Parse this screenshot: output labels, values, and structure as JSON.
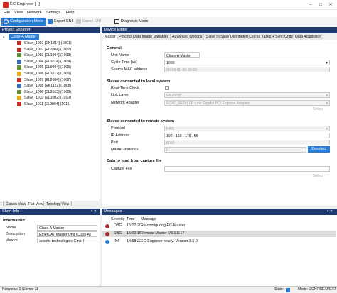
{
  "window": {
    "title": "EC-Engineer [--]"
  },
  "menu": [
    "File",
    "View",
    "Network",
    "Settings",
    "Help"
  ],
  "toolbar": {
    "config_mode": "Configuration Mode",
    "export_eni": "Export ENI",
    "export_eni_2": "Export ENI",
    "diagnosis_mode": "Diagnosis Mode"
  },
  "project_explorer": {
    "title": "Project Explorer",
    "root": "Class-A Master",
    "slaves": [
      {
        "label": "Slave_1001 [EK1814] (1001)",
        "color": "#c03028"
      },
      {
        "label": "Slave_1002 [EL2004] (1002)",
        "color": "#c03028"
      },
      {
        "label": "Slave_1003 [EL1004] (1003)",
        "color": "#6a8f3a"
      },
      {
        "label": "Slave_1004 [EL1014] (1004)",
        "color": "#3d6fb0"
      },
      {
        "label": "Slave_1005 [EL9004] (1005)",
        "color": "#6a8f3a"
      },
      {
        "label": "Slave_1006 [EL1012] (1006)",
        "color": "#e0b020"
      },
      {
        "label": "Slave_1007 [EL2004] (1007)",
        "color": "#c03028"
      },
      {
        "label": "Slave_1008 [EK1122] (1008)",
        "color": "#3d6fb0"
      },
      {
        "label": "Slave_1009 [EL3162] (1009)",
        "color": "#6a8f3a"
      },
      {
        "label": "Slave_1010 [EL1002] (1010)",
        "color": "#e0b020"
      },
      {
        "label": "Slave_1011 [EL2004] (1011)",
        "color": "#c03028"
      }
    ],
    "bottom_tabs": [
      "Classic View",
      "Flat View",
      "Topology View"
    ]
  },
  "device_editor": {
    "title": "Device Editor",
    "tabs": [
      "Master",
      "Process Data Image",
      "Variables",
      "Advanced Options",
      "Slave to Slave",
      "Distributed Clocks",
      "Tasks + Sync Units",
      "Data Acquisition"
    ],
    "general": {
      "heading": "General",
      "unit_name_label": "Unit Name",
      "unit_name": "Class-A Master",
      "cycle_time_label": "Cycle Time [us]",
      "cycle_time": "1000",
      "mac_label": "Source MAC address",
      "mac": "00-00-00-00-00-00"
    },
    "local": {
      "heading": "Slaves connected to local system",
      "rt_clock_label": "Real-Time Clock",
      "link_layer_label": "Link Layer",
      "link_layer": "WinPcap",
      "adapter_label": "Network Adapter",
      "adapter": "ECAT_RED | TP-Link Gigabit PCI Express Adapter",
      "select": "Select"
    },
    "remote": {
      "heading": "Slaves connected to remote system",
      "protocol_label": "Protocol",
      "protocol": "RAS",
      "ip_label": "IP Address",
      "ip": "192 . 168 . 178 . 55",
      "port_label": "Port",
      "port": "6000",
      "instance_label": "Master-Instance",
      "instance": "0",
      "deselect": "Deselect"
    },
    "capture": {
      "heading": "Data to load from capture file",
      "file_label": "Capture File",
      "select": "Select"
    }
  },
  "short_info": {
    "title": "Short Info",
    "heading": "Information",
    "rows": [
      {
        "key": "Name",
        "value": "Class-A Master"
      },
      {
        "key": "Description",
        "value": "EtherCAT Master Unit (Class A)"
      },
      {
        "key": "Vendor",
        "value": "acontis technologies GmbH"
      }
    ]
  },
  "messages": {
    "title": "Messages",
    "columns": [
      "Severity",
      "Time",
      "Message"
    ],
    "rows": [
      {
        "severity": "DBG",
        "time": "15:02:20",
        "message": "Re-configuring EC-Master",
        "color": "#b03030"
      },
      {
        "severity": "DBG",
        "time": "15:02:16",
        "message": "Remote Master V3.1.0.17",
        "color": "#b03030"
      },
      {
        "severity": "INF",
        "time": "14:58:22",
        "message": "EC-Engineer ready. Version 3.5.0",
        "color": "#2a7bd3"
      }
    ]
  },
  "status_bar": {
    "networks": "Networks: 1",
    "slaves": "Slaves: 11",
    "state_label": "State:",
    "mode": "Mode: CONFIG",
    "level": "EXPERT"
  }
}
